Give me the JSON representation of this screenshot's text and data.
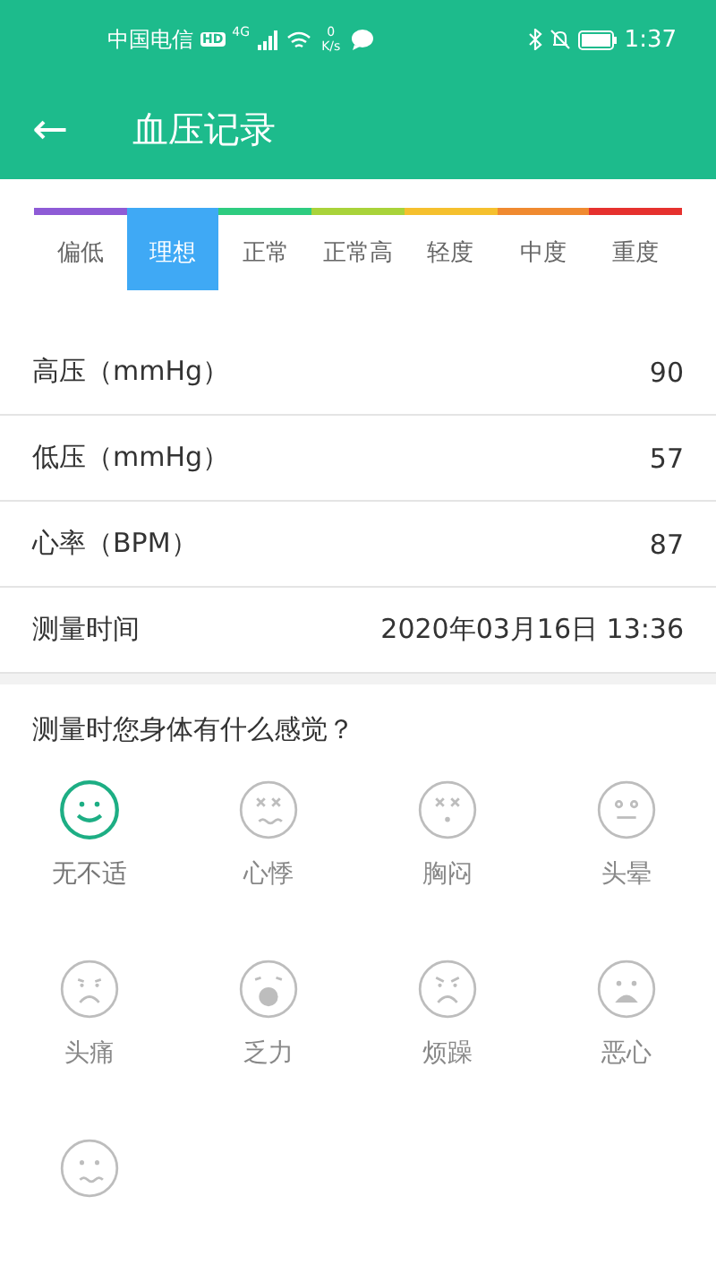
{
  "status_bar": {
    "carrier": "中国电信",
    "network_badge": "HD",
    "net_type": "4G",
    "speed_value": "0",
    "speed_unit": "K/s",
    "time": "1:37"
  },
  "header": {
    "back": "←",
    "title": "血压记录"
  },
  "levels": [
    {
      "label": "偏低",
      "color": "#8e5bd6",
      "selected": false
    },
    {
      "label": "理想",
      "color": "#3fa9f5",
      "selected": true
    },
    {
      "label": "正常",
      "color": "#2ecc80",
      "selected": false
    },
    {
      "label": "正常高",
      "color": "#a9d33a",
      "selected": false
    },
    {
      "label": "轻度",
      "color": "#f5c02e",
      "selected": false
    },
    {
      "label": "中度",
      "color": "#f08a30",
      "selected": false
    },
    {
      "label": "重度",
      "color": "#e6312e",
      "selected": false
    }
  ],
  "readings": [
    {
      "label": "高压（mmHg）",
      "value": "90"
    },
    {
      "label": "低压（mmHg）",
      "value": "57"
    },
    {
      "label": "心率（BPM）",
      "value": "87"
    },
    {
      "label": "测量时间",
      "value": "2020年03月16日 13:36"
    }
  ],
  "question": "测量时您身体有什么感觉？",
  "symptoms": [
    {
      "label": "无不适",
      "kind": "smile",
      "selected": true
    },
    {
      "label": "心悸",
      "kind": "x-wavy",
      "selected": false
    },
    {
      "label": "胸闷",
      "kind": "x-dot",
      "selected": false
    },
    {
      "label": "头晕",
      "kind": "dizzy",
      "selected": false
    },
    {
      "label": "头痛",
      "kind": "pained",
      "selected": false
    },
    {
      "label": "乏力",
      "kind": "yawn",
      "selected": false
    },
    {
      "label": "烦躁",
      "kind": "angry",
      "selected": false
    },
    {
      "label": "恶心",
      "kind": "sad",
      "selected": false
    },
    {
      "kind": "wavy",
      "selected": false
    }
  ]
}
